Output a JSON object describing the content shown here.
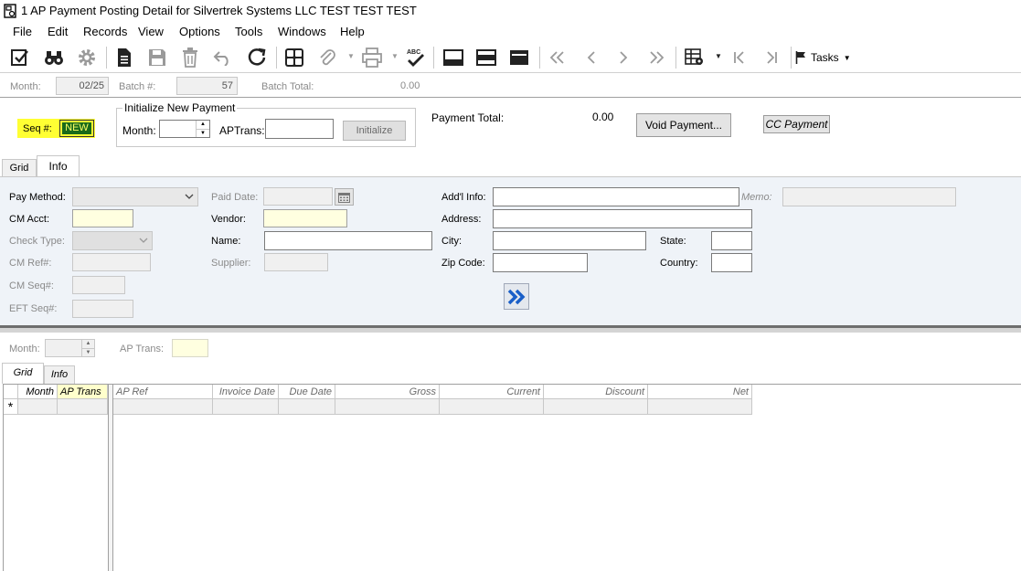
{
  "window": {
    "title": "1 AP Payment Posting Detail for Silvertrek Systems LLC TEST TEST TEST"
  },
  "menu": [
    "File",
    "Edit",
    "Records",
    "View",
    "Options",
    "Tools",
    "Windows",
    "Help"
  ],
  "toolbar": {
    "tasks_label": "Tasks"
  },
  "batch": {
    "month_label": "Month:",
    "month_value": "02/25",
    "batch_label": "Batch #:",
    "batch_value": "57",
    "total_label": "Batch Total:",
    "total_value": "0.00"
  },
  "seq": {
    "label": "Seq #:",
    "value": "NEW"
  },
  "init": {
    "legend": "Initialize New Payment",
    "month_label": "Month:",
    "aptrans_label": "APTrans:",
    "button": "Initialize"
  },
  "payment": {
    "total_label": "Payment Total:",
    "total_value": "0.00",
    "void_button": "Void Payment...",
    "cc_button": "CC Payment"
  },
  "top_tabs": [
    "Grid",
    "Info"
  ],
  "info": {
    "pay_method": "Pay Method:",
    "cm_acct": "CM Acct:",
    "check_type": "Check Type:",
    "cm_ref": "CM Ref#:",
    "cm_seq": "CM Seq#:",
    "eft_seq": "EFT Seq#:",
    "paid_date": "Paid Date:",
    "vendor": "Vendor:",
    "name": "Name:",
    "supplier": "Supplier:",
    "addl_info": "Add'l Info:",
    "memo": "Memo:",
    "address": "Address:",
    "city": "City:",
    "state": "State:",
    "zip": "Zip Code:",
    "country": "Country:"
  },
  "lower": {
    "month_label": "Month:",
    "ap_trans_label": "AP Trans:"
  },
  "bottom_tabs": [
    "Grid",
    "Info"
  ],
  "grid": {
    "left_headers": [
      "Month",
      "AP Trans"
    ],
    "right_headers": [
      "AP Ref",
      "Invoice Date",
      "Due Date",
      "Gross",
      "Current",
      "Discount",
      "Net"
    ],
    "new_row_marker": "*"
  }
}
